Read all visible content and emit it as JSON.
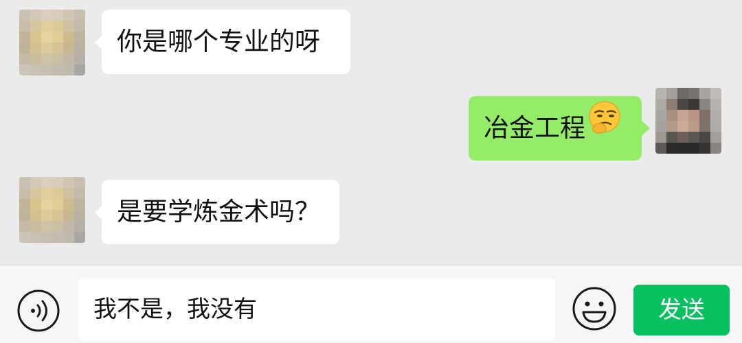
{
  "messages": [
    {
      "side": "left",
      "text": "你是哪个专业的呀"
    },
    {
      "side": "right",
      "text": "冶金工程",
      "emoji": "smirk-thinking-emoji"
    },
    {
      "side": "left",
      "text": "是要学炼金术吗？"
    }
  ],
  "input": {
    "value": "我不是，我没有",
    "voice_icon": "voice-icon",
    "emoji_icon": "smiley-icon",
    "send_label": "发送"
  },
  "colors": {
    "chat_background": "#ebebeb",
    "bubble_incoming": "#ffffff",
    "bubble_outgoing": "#95ec69",
    "send_button": "#07c160"
  }
}
